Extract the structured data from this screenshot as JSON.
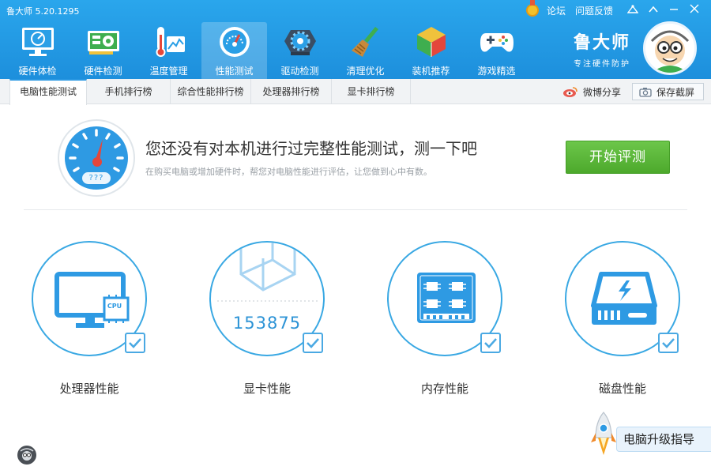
{
  "app": {
    "title": "鲁大师 5.20.1295"
  },
  "top_links": {
    "forum": "论坛",
    "feedback": "问题反馈"
  },
  "nav": [
    {
      "label": "硬件体检",
      "icon": "monitor-icon"
    },
    {
      "label": "硬件检测",
      "icon": "graphics-card-icon"
    },
    {
      "label": "温度管理",
      "icon": "thermometer-icon"
    },
    {
      "label": "性能测试",
      "icon": "speedometer-icon",
      "active": true
    },
    {
      "label": "驱动检测",
      "icon": "gear-icon"
    },
    {
      "label": "清理优化",
      "icon": "broom-icon"
    },
    {
      "label": "装机推荐",
      "icon": "cube-icon"
    },
    {
      "label": "游戏精选",
      "icon": "gamepad-icon"
    }
  ],
  "brand": {
    "name": "鲁大师",
    "tagline": "专注硬件防护"
  },
  "tabs": [
    {
      "label": "电脑性能测试",
      "active": true
    },
    {
      "label": "手机排行榜"
    },
    {
      "label": "综合性能排行榜"
    },
    {
      "label": "处理器排行榜"
    },
    {
      "label": "显卡排行榜"
    }
  ],
  "toolbar": {
    "share_label": "微博分享",
    "save_label": "保存截屏"
  },
  "hero": {
    "gauge_text": "???",
    "title": "您还没有对本机进行过完整性能测试，测一下吧",
    "desc": "在购买电脑或增加硬件时，帮您对电脑性能进行评估，让您做到心中有数。",
    "start_label": "开始评测"
  },
  "cards": [
    {
      "label": "处理器性能",
      "icon": "cpu-monitor-icon",
      "badge": "CPU"
    },
    {
      "label": "显卡性能",
      "icon": "graphics-cube-icon",
      "score": "153875"
    },
    {
      "label": "内存性能",
      "icon": "memory-chip-icon"
    },
    {
      "label": "磁盘性能",
      "icon": "disk-drive-icon"
    }
  ],
  "bottom": {
    "guide_label": "电脑升级指导"
  },
  "colors": {
    "header": "#1f95df",
    "accent": "#39a8e3",
    "start_button": "#55b132"
  }
}
